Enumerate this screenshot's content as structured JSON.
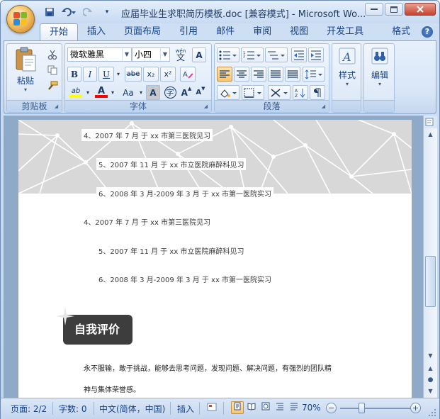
{
  "window": {
    "title": "应届毕业生求职简历模板.doc [兼容模式] - Microsoft Wo...",
    "controls": {
      "minimize": "0",
      "maximize": "1",
      "close": "r"
    }
  },
  "quick_access": {
    "save_icon": "save-icon",
    "undo_icon": "undo-icon",
    "redo_icon": "redo-icon",
    "more_icon": "customize-icon"
  },
  "tabs": [
    {
      "label": "开始",
      "active": true
    },
    {
      "label": "插入"
    },
    {
      "label": "页面布局"
    },
    {
      "label": "引用"
    },
    {
      "label": "邮件"
    },
    {
      "label": "审阅"
    },
    {
      "label": "视图"
    },
    {
      "label": "开发工具"
    },
    {
      "label": "格式"
    }
  ],
  "ribbon": {
    "clipboard": {
      "label": "剪贴板",
      "paste": "粘贴"
    },
    "font": {
      "label": "字体",
      "font_name": "微软雅黑",
      "font_size": "小四",
      "wen": "wén",
      "wen_char": "文",
      "a_box": "A",
      "bold": "B",
      "italic": "I",
      "underline": "U",
      "strike": "abe",
      "subscript": "x₂",
      "superscript": "x²",
      "highlight": "ab",
      "font_color": "A",
      "change_case": "Aa",
      "char_shade": "A",
      "enclose": "字",
      "grow": "A",
      "shrink": "A",
      "clear_format": "A"
    },
    "paragraph": {
      "label": "段落"
    },
    "styles": {
      "label": "样式"
    },
    "editing": {
      "label": "编辑"
    },
    "colors": {
      "highlight_color": "#ffff00",
      "font_color": "#ff0000",
      "accent": "#15428b"
    }
  },
  "document": {
    "banner_lines": [
      "4、2007 年 7 月  于 xx 市第三医院见习",
      "5、2007 年 11 月  于 xx 市立医院麻醉科见习",
      "6、2008 年 3 月-2009 年 3 月  于 xx 市第一医院实习"
    ],
    "body_lines": [
      "4、2007 年 7 月  于 xx 市第三医院见习",
      "5、2007 年 11 月  于 xx 市立医院麻醉科见习",
      "6、2008 年 3 月-2009 年 3 月  于 xx 市第一医院实习"
    ],
    "section_title": "自我评价",
    "paragraph_lines": [
      "永不服输，敢于挑战，能够去思考问题，发现问题、解决问题，有强烈的团队精",
      "神与集体荣誉感。"
    ]
  },
  "statusbar": {
    "page": "页面: 2/2",
    "words": "字数: 0",
    "language": "中文(简体，中国)",
    "insert_mode": "插入",
    "zoom": "70%",
    "zoom_level": 0.3
  }
}
